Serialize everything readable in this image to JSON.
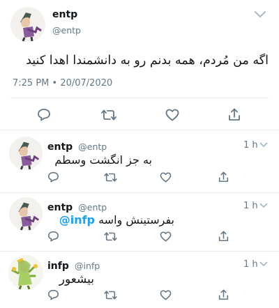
{
  "main_tweet": {
    "display_name": "entp",
    "handle": "@entp",
    "text": "اگه من مُردم، همه بدنم رو به دانشمندا اهدا کنید",
    "timestamp": "7:25 PM • 20/07/2020",
    "avatar_icon": "entp-character-avatar",
    "menu_icon": "chevron-down-icon",
    "actions": [
      "reply-icon",
      "retweet-icon",
      "like-icon",
      "share-icon"
    ]
  },
  "replies": [
    {
      "display_name": "entp",
      "handle": "@entp",
      "time": "1 h",
      "text": "به جز انگشت وسطم",
      "avatar_icon": "entp-character-avatar"
    },
    {
      "display_name": "entp",
      "handle": "@entp",
      "time": "1 h",
      "text": "بفرستینش واسه ",
      "mention": "@infp",
      "avatar_icon": "entp-character-avatar"
    },
    {
      "display_name": "infp",
      "handle": "@infp",
      "time": "1 h",
      "text": "بیشعور",
      "avatar_icon": "infp-character-avatar"
    }
  ],
  "colors": {
    "text": "#14171a",
    "muted": "#657786",
    "icon": "#657786",
    "mention": "#1da1f2",
    "divider": "#e6ecf0"
  }
}
